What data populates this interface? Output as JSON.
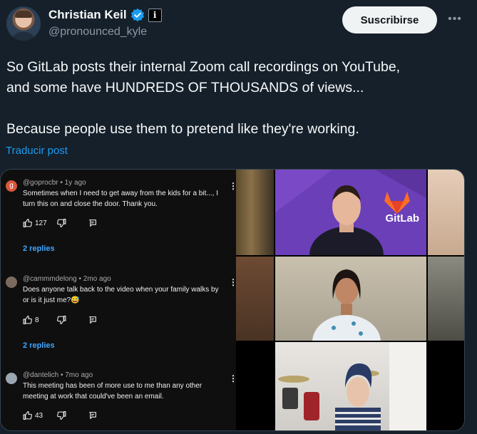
{
  "author": {
    "display_name": "Christian Keil",
    "handle": "@pronounced_kyle",
    "affiliation_badge": "i"
  },
  "actions": {
    "follow_label": "Suscribirse",
    "more_label": "•••"
  },
  "tweet": {
    "lines": [
      "So GitLab posts their internal Zoom call recordings on YouTube,",
      "and some have HUNDREDS OF THOUSANDS of views...",
      "",
      "Because people use them to pretend like they're working."
    ],
    "translate_label": "Traducir post"
  },
  "media": {
    "comments": [
      {
        "meta": "@goprocbr • 1y ago",
        "text": "Sometimes when I need to get away from the kids for a bit..., I turn this on and close the door.  Thank you.",
        "likes": "127",
        "replies": "2 replies",
        "avatar_letter": "g",
        "avatar_color": "#d8563c"
      },
      {
        "meta": "@cammmdelong • 2mo ago",
        "text": "Does anyone talk back to the video when your family walks by or is it just me?😅",
        "likes": "8",
        "replies": "2 replies",
        "avatar_color": "#7d6a5e"
      },
      {
        "meta": "@dantelich • 7mo ago",
        "text": "This meeting has been of more use to me than any other meeting at work that could've been an email.",
        "likes": "43",
        "replies": "",
        "avatar_color": "#9aa6b0"
      }
    ],
    "video": {
      "brand_label": "GitLab"
    }
  },
  "colors": {
    "background": "#15202b",
    "accent": "#1d9bf0",
    "replies_link": "#3ea6ff"
  }
}
